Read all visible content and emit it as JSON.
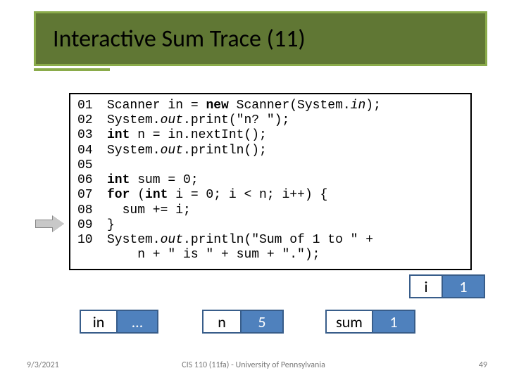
{
  "title": "Interactive Sum Trace (11)",
  "code": {
    "lines": [
      {
        "n": "01",
        "text": "Scanner in = new Scanner(System.in);",
        "segs": [
          {
            "t": "Scanner in = "
          },
          {
            "t": "new",
            "cls": "kw"
          },
          {
            "t": " Scanner(System."
          },
          {
            "t": "in",
            "cls": "it"
          },
          {
            "t": ");"
          }
        ]
      },
      {
        "n": "02",
        "text": "System.out.print(\"n? \");",
        "segs": [
          {
            "t": "System."
          },
          {
            "t": "out",
            "cls": "it"
          },
          {
            "t": ".print("
          },
          {
            "t": "\"n? \"",
            "cls": "str"
          },
          {
            "t": ");"
          }
        ]
      },
      {
        "n": "03",
        "text": "int n = in.nextInt();",
        "segs": [
          {
            "t": "int",
            "cls": "kw"
          },
          {
            "t": " n = in.nextInt();"
          }
        ]
      },
      {
        "n": "04",
        "text": "System.out.println();",
        "segs": [
          {
            "t": "System."
          },
          {
            "t": "out",
            "cls": "it"
          },
          {
            "t": ".println();"
          }
        ]
      },
      {
        "n": "05",
        "text": "",
        "segs": []
      },
      {
        "n": "06",
        "text": "int sum = 0;",
        "segs": [
          {
            "t": "int",
            "cls": "kw"
          },
          {
            "t": " sum = 0;"
          }
        ]
      },
      {
        "n": "07",
        "text": "for (int i = 0; i < n; i++) {",
        "segs": [
          {
            "t": "for",
            "cls": "kw"
          },
          {
            "t": " ("
          },
          {
            "t": "int",
            "cls": "kw"
          },
          {
            "t": " i = 0; i < n; i++) {"
          }
        ]
      },
      {
        "n": "08",
        "text": "  sum += i;",
        "segs": [
          {
            "t": "  sum += i;"
          }
        ]
      },
      {
        "n": "09",
        "text": "}",
        "segs": [
          {
            "t": "}"
          }
        ]
      },
      {
        "n": "10",
        "text": "System.out.println(\"Sum of 1 to \" +",
        "segs": [
          {
            "t": "System."
          },
          {
            "t": "out",
            "cls": "it"
          },
          {
            "t": ".println("
          },
          {
            "t": "\"Sum of 1 to \"",
            "cls": "str"
          },
          {
            "t": " +"
          }
        ]
      },
      {
        "n": "",
        "text": "    n + \" is \" + sum + \".\");",
        "segs": [
          {
            "t": "    n + "
          },
          {
            "t": "\" is \"",
            "cls": "str"
          },
          {
            "t": " + sum + "
          },
          {
            "t": "\".\"",
            "cls": "str"
          },
          {
            "t": ");"
          }
        ]
      }
    ]
  },
  "vars": {
    "i": {
      "label": "i",
      "value": "1"
    },
    "in": {
      "label": "in",
      "value": "…"
    },
    "n": {
      "label": "n",
      "value": "5"
    },
    "sum": {
      "label": "sum",
      "value": "1"
    }
  },
  "arrow_line": "08",
  "footer": {
    "date": "9/3/2021",
    "center": "CIS 110 (11fa) - University of Pennsylvania",
    "page": "49"
  }
}
